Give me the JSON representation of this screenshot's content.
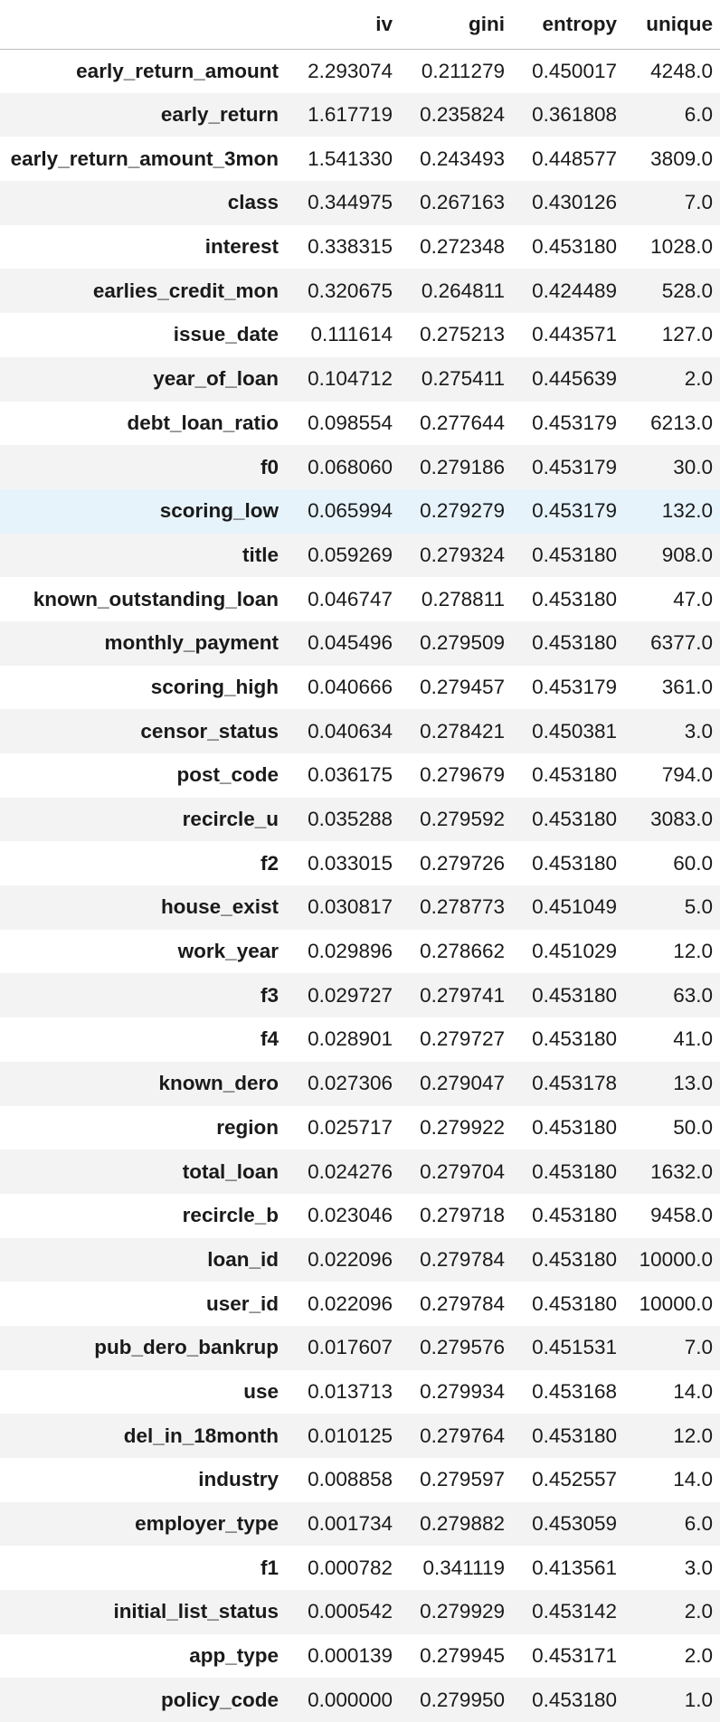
{
  "columns": [
    "",
    "iv",
    "gini",
    "entropy",
    "unique"
  ],
  "highlight_color": "#e6f3fb",
  "stripe_color": "#f3f3f3",
  "rows": [
    {
      "name": "early_return_amount",
      "iv": "2.293074",
      "gini": "0.211279",
      "entropy": "0.450017",
      "unique": "4248.0"
    },
    {
      "name": "early_return",
      "iv": "1.617719",
      "gini": "0.235824",
      "entropy": "0.361808",
      "unique": "6.0"
    },
    {
      "name": "early_return_amount_3mon",
      "iv": "1.541330",
      "gini": "0.243493",
      "entropy": "0.448577",
      "unique": "3809.0"
    },
    {
      "name": "class",
      "iv": "0.344975",
      "gini": "0.267163",
      "entropy": "0.430126",
      "unique": "7.0"
    },
    {
      "name": "interest",
      "iv": "0.338315",
      "gini": "0.272348",
      "entropy": "0.453180",
      "unique": "1028.0"
    },
    {
      "name": "earlies_credit_mon",
      "iv": "0.320675",
      "gini": "0.264811",
      "entropy": "0.424489",
      "unique": "528.0"
    },
    {
      "name": "issue_date",
      "iv": "0.111614",
      "gini": "0.275213",
      "entropy": "0.443571",
      "unique": "127.0"
    },
    {
      "name": "year_of_loan",
      "iv": "0.104712",
      "gini": "0.275411",
      "entropy": "0.445639",
      "unique": "2.0"
    },
    {
      "name": "debt_loan_ratio",
      "iv": "0.098554",
      "gini": "0.277644",
      "entropy": "0.453179",
      "unique": "6213.0"
    },
    {
      "name": "f0",
      "iv": "0.068060",
      "gini": "0.279186",
      "entropy": "0.453179",
      "unique": "30.0"
    },
    {
      "name": "scoring_low",
      "iv": "0.065994",
      "gini": "0.279279",
      "entropy": "0.453179",
      "unique": "132.0",
      "highlighted": true
    },
    {
      "name": "title",
      "iv": "0.059269",
      "gini": "0.279324",
      "entropy": "0.453180",
      "unique": "908.0"
    },
    {
      "name": "known_outstanding_loan",
      "iv": "0.046747",
      "gini": "0.278811",
      "entropy": "0.453180",
      "unique": "47.0"
    },
    {
      "name": "monthly_payment",
      "iv": "0.045496",
      "gini": "0.279509",
      "entropy": "0.453180",
      "unique": "6377.0"
    },
    {
      "name": "scoring_high",
      "iv": "0.040666",
      "gini": "0.279457",
      "entropy": "0.453179",
      "unique": "361.0"
    },
    {
      "name": "censor_status",
      "iv": "0.040634",
      "gini": "0.278421",
      "entropy": "0.450381",
      "unique": "3.0"
    },
    {
      "name": "post_code",
      "iv": "0.036175",
      "gini": "0.279679",
      "entropy": "0.453180",
      "unique": "794.0"
    },
    {
      "name": "recircle_u",
      "iv": "0.035288",
      "gini": "0.279592",
      "entropy": "0.453180",
      "unique": "3083.0"
    },
    {
      "name": "f2",
      "iv": "0.033015",
      "gini": "0.279726",
      "entropy": "0.453180",
      "unique": "60.0"
    },
    {
      "name": "house_exist",
      "iv": "0.030817",
      "gini": "0.278773",
      "entropy": "0.451049",
      "unique": "5.0"
    },
    {
      "name": "work_year",
      "iv": "0.029896",
      "gini": "0.278662",
      "entropy": "0.451029",
      "unique": "12.0"
    },
    {
      "name": "f3",
      "iv": "0.029727",
      "gini": "0.279741",
      "entropy": "0.453180",
      "unique": "63.0"
    },
    {
      "name": "f4",
      "iv": "0.028901",
      "gini": "0.279727",
      "entropy": "0.453180",
      "unique": "41.0"
    },
    {
      "name": "known_dero",
      "iv": "0.027306",
      "gini": "0.279047",
      "entropy": "0.453178",
      "unique": "13.0"
    },
    {
      "name": "region",
      "iv": "0.025717",
      "gini": "0.279922",
      "entropy": "0.453180",
      "unique": "50.0"
    },
    {
      "name": "total_loan",
      "iv": "0.024276",
      "gini": "0.279704",
      "entropy": "0.453180",
      "unique": "1632.0"
    },
    {
      "name": "recircle_b",
      "iv": "0.023046",
      "gini": "0.279718",
      "entropy": "0.453180",
      "unique": "9458.0"
    },
    {
      "name": "loan_id",
      "iv": "0.022096",
      "gini": "0.279784",
      "entropy": "0.453180",
      "unique": "10000.0"
    },
    {
      "name": "user_id",
      "iv": "0.022096",
      "gini": "0.279784",
      "entropy": "0.453180",
      "unique": "10000.0"
    },
    {
      "name": "pub_dero_bankrup",
      "iv": "0.017607",
      "gini": "0.279576",
      "entropy": "0.451531",
      "unique": "7.0"
    },
    {
      "name": "use",
      "iv": "0.013713",
      "gini": "0.279934",
      "entropy": "0.453168",
      "unique": "14.0"
    },
    {
      "name": "del_in_18month",
      "iv": "0.010125",
      "gini": "0.279764",
      "entropy": "0.453180",
      "unique": "12.0"
    },
    {
      "name": "industry",
      "iv": "0.008858",
      "gini": "0.279597",
      "entropy": "0.452557",
      "unique": "14.0"
    },
    {
      "name": "employer_type",
      "iv": "0.001734",
      "gini": "0.279882",
      "entropy": "0.453059",
      "unique": "6.0"
    },
    {
      "name": "f1",
      "iv": "0.000782",
      "gini": "0.341119",
      "entropy": "0.413561",
      "unique": "3.0"
    },
    {
      "name": "initial_list_status",
      "iv": "0.000542",
      "gini": "0.279929",
      "entropy": "0.453142",
      "unique": "2.0"
    },
    {
      "name": "app_type",
      "iv": "0.000139",
      "gini": "0.279945",
      "entropy": "0.453171",
      "unique": "2.0"
    },
    {
      "name": "policy_code",
      "iv": "0.000000",
      "gini": "0.279950",
      "entropy": "0.453180",
      "unique": "1.0"
    }
  ]
}
